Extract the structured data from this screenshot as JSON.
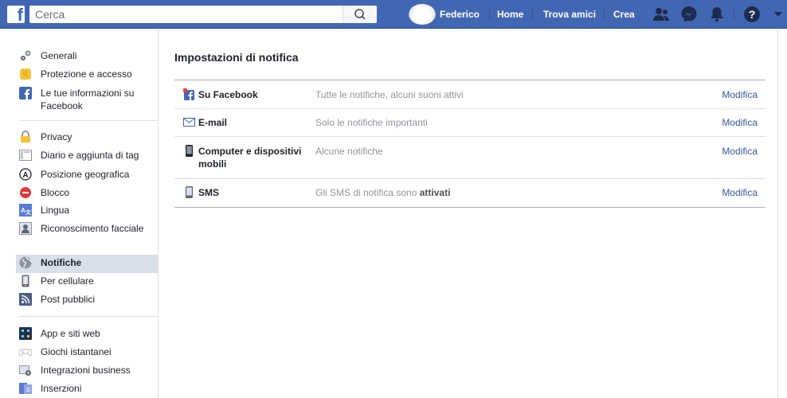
{
  "topbar": {
    "search_placeholder": "Cerca",
    "user_name": "Federico",
    "nav": [
      "Home",
      "Trova amici",
      "Crea"
    ]
  },
  "sidebar": {
    "groups": [
      [
        {
          "label": "Generali",
          "icon": "gear-icon"
        },
        {
          "label": "Protezione e accesso",
          "icon": "shield-icon"
        },
        {
          "label": "Le tue informazioni su Facebook",
          "icon": "facebook-icon"
        }
      ],
      [
        {
          "label": "Privacy",
          "icon": "lock-icon"
        },
        {
          "label": "Diario e aggiunta di tag",
          "icon": "timeline-icon"
        },
        {
          "label": "Posizione geografica",
          "icon": "location-icon"
        },
        {
          "label": "Blocco",
          "icon": "block-icon"
        },
        {
          "label": "Lingua",
          "icon": "language-icon"
        },
        {
          "label": "Riconoscimento facciale",
          "icon": "face-icon"
        }
      ],
      [
        {
          "label": "Notifiche",
          "icon": "globe-icon",
          "selected": true
        },
        {
          "label": "Per cellulare",
          "icon": "mobile-icon"
        },
        {
          "label": "Post pubblici",
          "icon": "rss-icon"
        }
      ],
      [
        {
          "label": "App e siti web",
          "icon": "apps-icon"
        },
        {
          "label": "Giochi istantanei",
          "icon": "gamepad-icon"
        },
        {
          "label": "Integrazioni business",
          "icon": "business-icon"
        },
        {
          "label": "Inserzioni",
          "icon": "ads-icon"
        }
      ]
    ]
  },
  "main": {
    "title": "Impostazioni di notifica",
    "rows": [
      {
        "title": "Su Facebook",
        "desc": "Tutte le notifiche, alcuni suoni attivi",
        "edit": "Modifica",
        "icon": "facebook-notification-icon"
      },
      {
        "title": "E-mail",
        "desc": "Solo le notifiche importanti",
        "edit": "Modifica",
        "icon": "envelope-icon"
      },
      {
        "title": "Computer e dispositivi mobili",
        "desc": "Alcune notifiche",
        "edit": "Modifica",
        "icon": "phone-icon"
      },
      {
        "title": "SMS",
        "desc": "Gli SMS di notifica sono ",
        "desc_bold": "attivati",
        "edit": "Modifica",
        "icon": "sms-icon"
      }
    ]
  },
  "colors": {
    "brand": "#4267b2",
    "link": "#365899",
    "selected": "#d8dfea"
  }
}
